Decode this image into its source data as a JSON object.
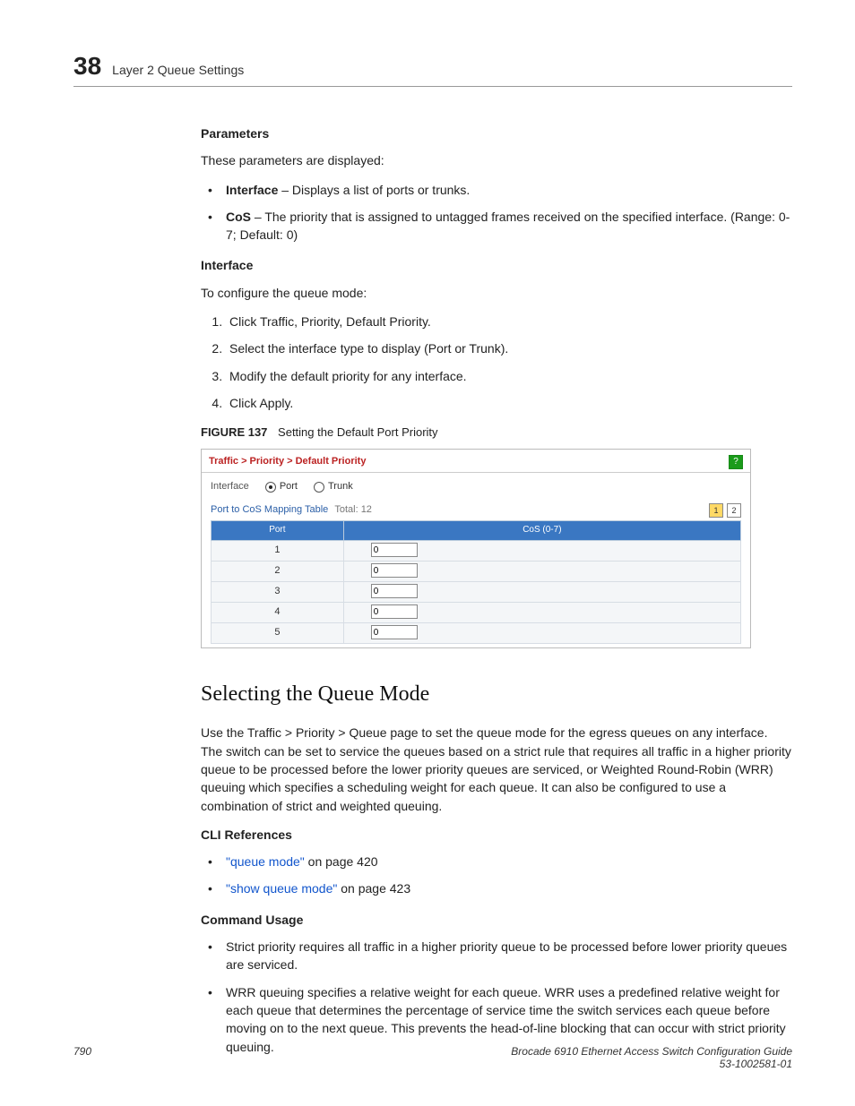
{
  "header": {
    "chapter_number": "38",
    "chapter_title": "Layer 2 Queue Settings"
  },
  "parameters": {
    "heading": "Parameters",
    "intro": "These parameters are displayed:",
    "items": [
      {
        "term": "Interface",
        "desc": " – Displays a list of ports or trunks."
      },
      {
        "term": "CoS",
        "desc": " – The priority that is assigned to untagged frames received on the specified interface. (Range: 0-7; Default: 0)"
      }
    ]
  },
  "interface_section": {
    "heading": "Interface",
    "intro": "To configure the queue mode:",
    "steps": [
      "Click Traffic, Priority, Default Priority.",
      "Select the interface type to display (Port or Trunk).",
      "Modify the default priority for any interface.",
      "Click Apply."
    ]
  },
  "figure": {
    "label": "FIGURE 137",
    "title": "Setting the Default Port Priority",
    "breadcrumb": "Traffic > Priority > Default Priority",
    "help": "?",
    "interface_label": "Interface",
    "radio_port": "Port",
    "radio_trunk": "Trunk",
    "map_label": "Port to CoS Mapping Table",
    "map_total_label": "Total:",
    "map_total_value": "12",
    "pager": [
      "1",
      "2"
    ],
    "col_port": "Port",
    "col_cos": "CoS (0-7)",
    "rows": [
      {
        "port": "1",
        "cos": "0"
      },
      {
        "port": "2",
        "cos": "0"
      },
      {
        "port": "3",
        "cos": "0"
      },
      {
        "port": "4",
        "cos": "0"
      },
      {
        "port": "5",
        "cos": "0"
      }
    ]
  },
  "queue_mode": {
    "heading": "Selecting the Queue Mode",
    "para": "Use the Traffic > Priority > Queue page to set the queue mode for the egress queues on any interface. The switch can be set to service the queues based on a strict rule that requires all traffic in a higher priority queue to be processed before the lower priority queues are serviced, or Weighted Round-Robin (WRR) queuing which specifies a scheduling weight for each queue. It can also be configured to use a combination of strict and weighted queuing.",
    "cli_heading": "CLI References",
    "cli_items": [
      {
        "link": "\"queue mode\"",
        "rest": " on page 420"
      },
      {
        "link": "\"show queue mode\"",
        "rest": " on page 423"
      }
    ],
    "cmd_heading": "Command Usage",
    "cmd_items": [
      "Strict priority requires all traffic in a higher priority queue to be processed before lower priority queues are serviced.",
      "WRR queuing specifies a relative weight for each queue. WRR uses a predefined relative weight for each queue that determines the percentage of service time the switch services each queue before moving on to the next queue. This prevents the head-of-line blocking that can occur with strict priority queuing."
    ]
  },
  "footer": {
    "page": "790",
    "doc_title": "Brocade 6910 Ethernet Access Switch Configuration Guide",
    "doc_id": "53-1002581-01"
  }
}
